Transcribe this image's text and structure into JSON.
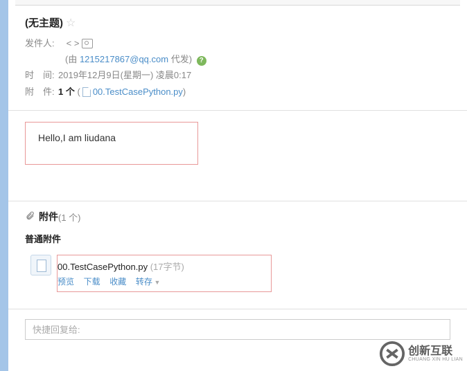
{
  "subject": "(无主题)",
  "sender": {
    "label": "发件人:",
    "brackets_open": "<",
    "brackets_close": ">",
    "proxy_prefix": "(由 ",
    "proxy_email": "1215217867@qq.com",
    "proxy_suffix": " 代发)"
  },
  "time": {
    "label": "时　间:",
    "value": "2019年12月9日(星期一) 凌晨0:17"
  },
  "attachment_meta": {
    "label": "附　件:",
    "count": "1 个",
    "open_paren": "(",
    "filename": "00.TestCasePython.py",
    "close_paren": ")"
  },
  "body": {
    "content": "Hello,I am liudana"
  },
  "attachments": {
    "section_title": "附件",
    "count_text": "(1 个)",
    "normal_label": "普通附件",
    "items": [
      {
        "filename": "00.TestCasePython.py",
        "size": "(17字节)",
        "actions": {
          "preview": "预览",
          "download": "下载",
          "favorite": "收藏",
          "forward": "转存"
        }
      }
    ]
  },
  "quick_reply": {
    "placeholder": "快捷回复给:"
  },
  "watermark": {
    "cn": "创新互联",
    "en": "CHUANG XIN HU LIAN"
  }
}
